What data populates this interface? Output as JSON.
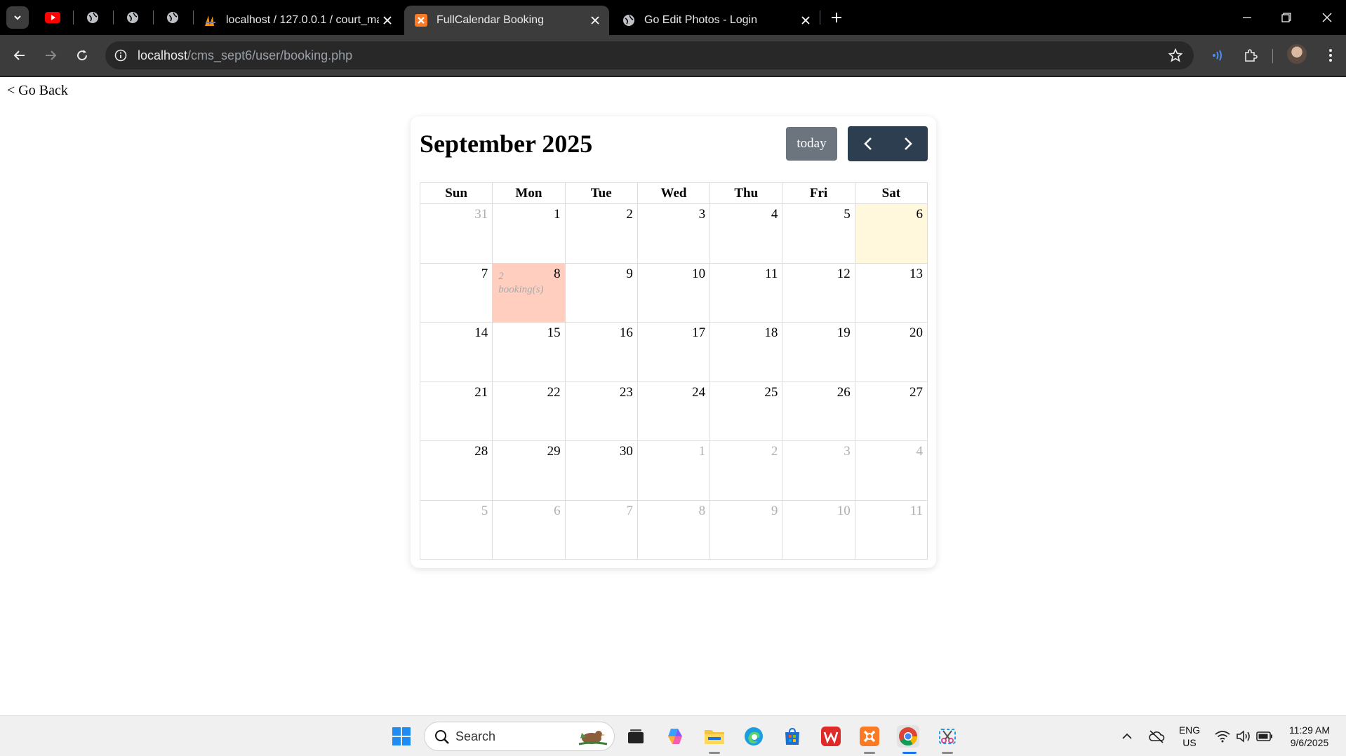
{
  "browser": {
    "tabs": [
      {
        "title": "localhost / 127.0.0.1 / court_ma",
        "active": false
      },
      {
        "title": "FullCalendar Booking",
        "active": true
      },
      {
        "title": "Go Edit Photos - Login",
        "active": false
      }
    ],
    "url_host": "localhost",
    "url_path": "/cms_sept6/user/booking.php"
  },
  "page": {
    "go_back": "< Go Back",
    "calendar": {
      "title": "September 2025",
      "today_label": "today",
      "weekdays": [
        "Sun",
        "Mon",
        "Tue",
        "Wed",
        "Thu",
        "Fri",
        "Sat"
      ],
      "weeks": [
        [
          {
            "d": "31",
            "other": true
          },
          {
            "d": "1"
          },
          {
            "d": "2"
          },
          {
            "d": "3"
          },
          {
            "d": "4"
          },
          {
            "d": "5"
          },
          {
            "d": "6",
            "today": true
          }
        ],
        [
          {
            "d": "7"
          },
          {
            "d": "8",
            "booked": true,
            "bookings_count": "2",
            "bookings_label": "booking(s)"
          },
          {
            "d": "9"
          },
          {
            "d": "10"
          },
          {
            "d": "11"
          },
          {
            "d": "12"
          },
          {
            "d": "13"
          }
        ],
        [
          {
            "d": "14"
          },
          {
            "d": "15"
          },
          {
            "d": "16"
          },
          {
            "d": "17"
          },
          {
            "d": "18"
          },
          {
            "d": "19"
          },
          {
            "d": "20"
          }
        ],
        [
          {
            "d": "21"
          },
          {
            "d": "22"
          },
          {
            "d": "23"
          },
          {
            "d": "24"
          },
          {
            "d": "25"
          },
          {
            "d": "26"
          },
          {
            "d": "27"
          }
        ],
        [
          {
            "d": "28"
          },
          {
            "d": "29"
          },
          {
            "d": "30"
          },
          {
            "d": "1",
            "other": true
          },
          {
            "d": "2",
            "other": true
          },
          {
            "d": "3",
            "other": true
          },
          {
            "d": "4",
            "other": true
          }
        ],
        [
          {
            "d": "5",
            "other": true
          },
          {
            "d": "6",
            "other": true
          },
          {
            "d": "7",
            "other": true
          },
          {
            "d": "8",
            "other": true
          },
          {
            "d": "9",
            "other": true
          },
          {
            "d": "10",
            "other": true
          },
          {
            "d": "11",
            "other": true
          }
        ]
      ]
    }
  },
  "taskbar": {
    "search_placeholder": "Search",
    "lang_top": "ENG",
    "lang_bottom": "US",
    "time": "11:29 AM",
    "date": "9/6/2025"
  },
  "colors": {
    "today_bg": "#fff8dc",
    "booked_bg": "#ffcebf",
    "nav_bg": "#2c3e50",
    "today_btn_bg": "#6c757d"
  }
}
